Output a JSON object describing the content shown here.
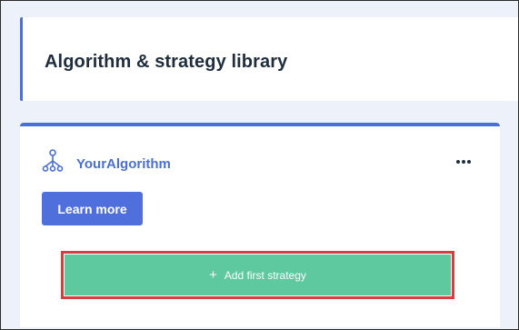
{
  "header": {
    "title": "Algorithm & strategy library"
  },
  "algorithm_card": {
    "icon": "algorithm-tree-icon",
    "name": "YourAlgorithm",
    "more_icon": "more-horizontal-icon",
    "learn_more_label": "Learn more",
    "add_strategy_label": "Add first strategy",
    "add_icon": "plus-icon"
  },
  "colors": {
    "accent": "#4a6fd6",
    "button_primary": "#4f6fdc",
    "add_button": "#5ec99f",
    "highlight_border": "#d93d3d",
    "background": "#edf1f9"
  }
}
